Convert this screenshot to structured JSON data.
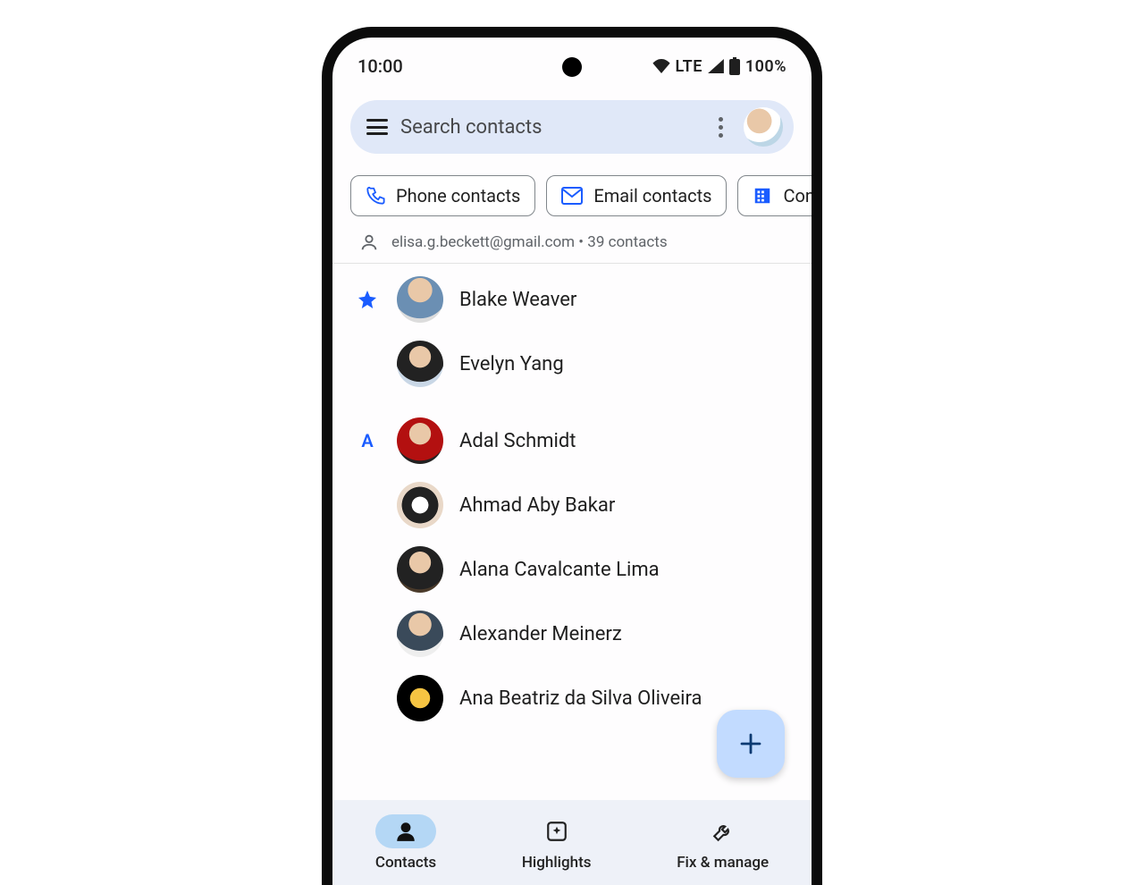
{
  "status": {
    "time": "10:00",
    "network": "LTE",
    "battery": "100%"
  },
  "search": {
    "placeholder": "Search contacts"
  },
  "chips": [
    {
      "label": "Phone contacts"
    },
    {
      "label": "Email contacts"
    },
    {
      "label": "Com"
    }
  ],
  "account": {
    "email": "elisa.g.beckett@gmail.com",
    "count_text": "39 contacts",
    "separator": " • "
  },
  "sections": {
    "star": [
      {
        "name": "Blake Weaver"
      },
      {
        "name": "Evelyn Yang"
      }
    ],
    "A": [
      {
        "name": "Adal Schmidt"
      },
      {
        "name": "Ahmad Aby Bakar"
      },
      {
        "name": "Alana Cavalcante Lima"
      },
      {
        "name": "Alexander Meinerz"
      },
      {
        "name": "Ana Beatriz da Silva Oliveira"
      }
    ]
  },
  "section_labels": {
    "A": "A"
  },
  "nav": {
    "contacts": "Contacts",
    "highlights": "Highlights",
    "fix_manage": "Fix & manage"
  }
}
